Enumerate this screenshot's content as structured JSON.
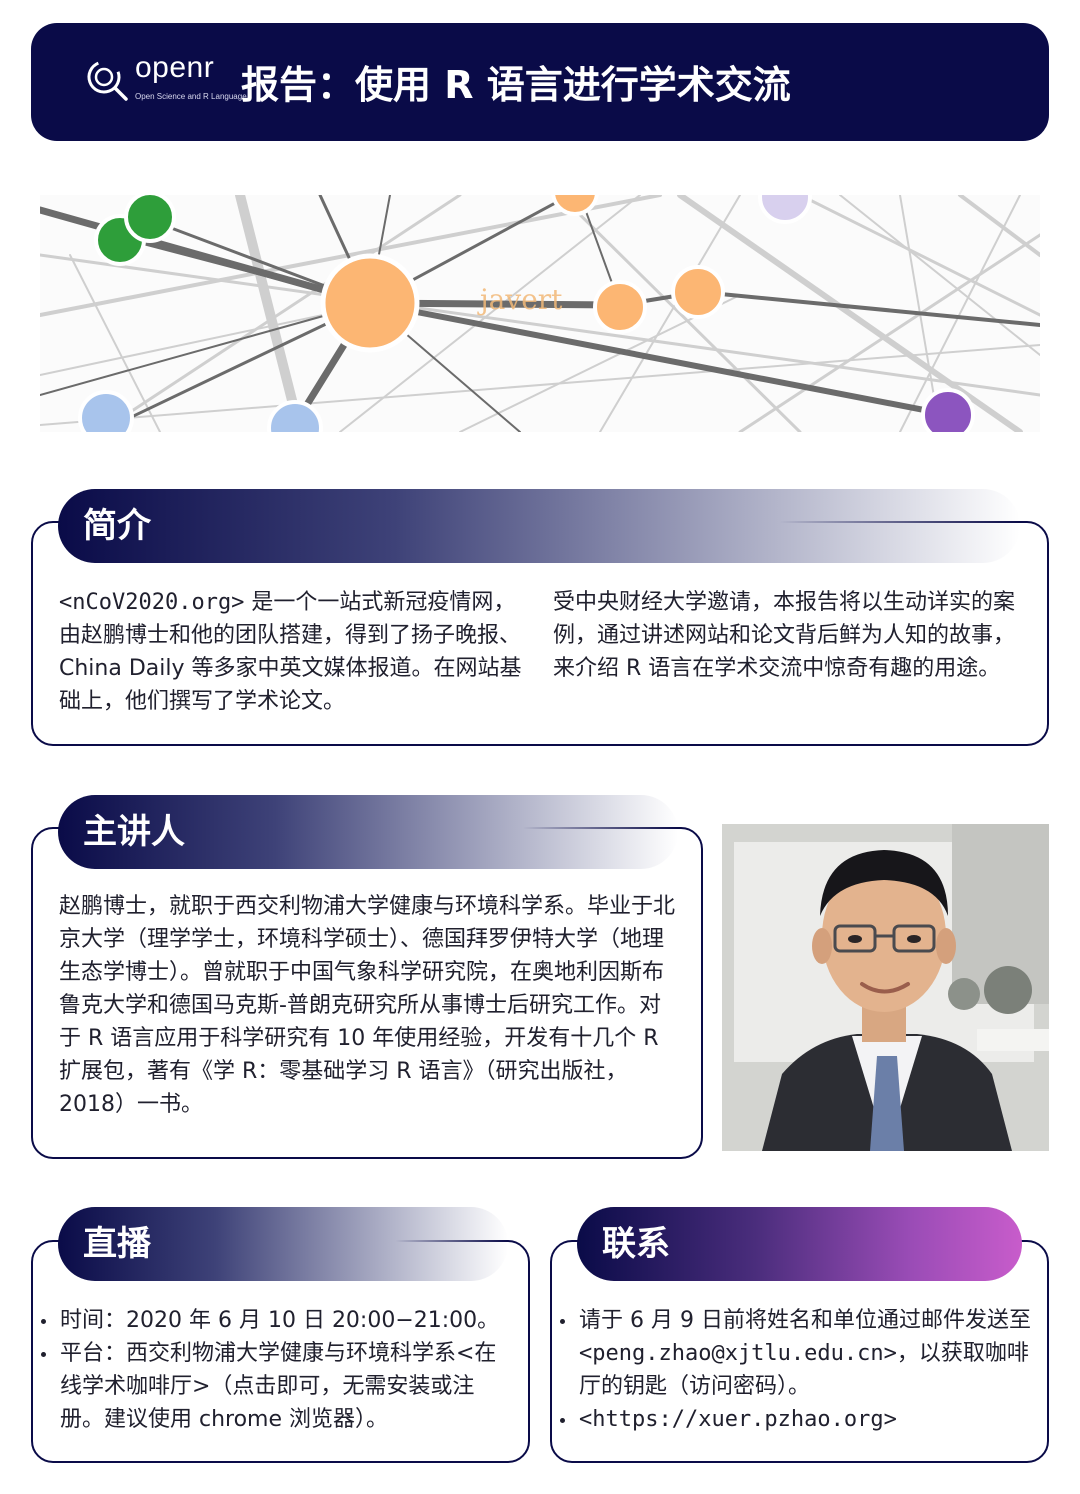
{
  "header": {
    "logo_name": "openr",
    "logo_tagline": "Open Science and R Language",
    "title": "报告：使用 R 语言进行学术交流",
    "logo_icon": "magnifier-r-icon",
    "colors": {
      "navy": "#0a0b48",
      "accent_purple": "#c85ccb"
    }
  },
  "banner": {
    "label": "javert",
    "image": "network-graph-illustration"
  },
  "intro": {
    "heading": "简介",
    "left_code": "<nCoV2020.org>",
    "left_text": " 是一个一站式新冠疫情网，由赵鹏博士和他的团队搭建，得到了扬子晚报、China Daily 等多家中英文媒体报道。在网站基础上，他们撰写了学术论文。",
    "right_text": "受中央财经大学邀请，本报告将以生动详实的案例，通过讲述网站和论文背后鲜为人知的故事，来介绍 R 语言在学术交流中惊奇有趣的用途。"
  },
  "speaker": {
    "heading": "主讲人",
    "bio": "赵鹏博士，就职于西交利物浦大学健康与环境科学系。毕业于北京大学（理学学士，环境科学硕士）、德国拜罗伊特大学（地理生态学博士）。曾就职于中国气象科学研究院，在奥地利因斯布鲁克大学和德国马克斯-普朗克研究所从事博士后研究工作。对于 R 语言应用于科学研究有 10 年使用经验，开发有十几个 R 扩展包，著有《学 R：零基础学习 R 语言》（研究出版社，2018）一书。",
    "photo": "speaker-portrait-photo"
  },
  "live": {
    "heading": "直播",
    "time_line": "时间：2020 年 6 月 10 日 20:00−21:00。",
    "platform_line": "平台：西交利物浦大学健康与环境科学系<在线学术咖啡厅>（点击即可，无需安装或注册。建议使用 chrome 浏览器）。"
  },
  "contact": {
    "heading": "联系",
    "email_pre": "请于 6 月 9 日前将姓名和单位通过邮件发送至 ",
    "email": "<peng.zhao@xjtlu.edu.cn>",
    "email_post": "，以获取咖啡厅的钥匙（访问密码）。",
    "url": "<https://xuer.pzhao.org>"
  }
}
